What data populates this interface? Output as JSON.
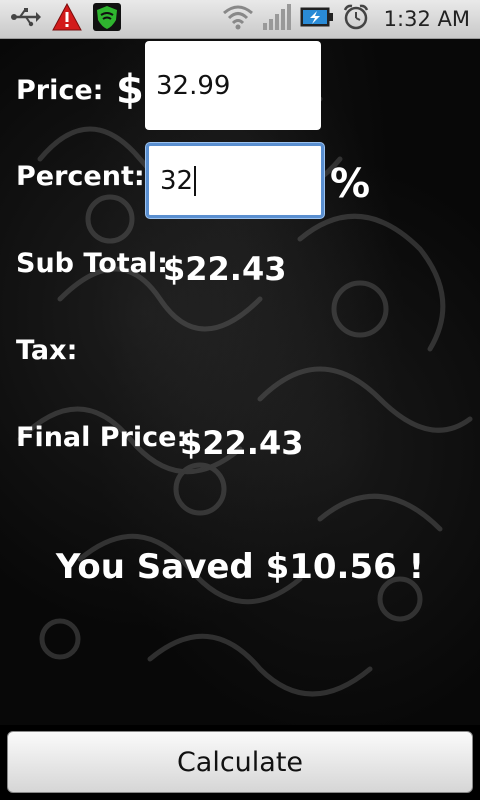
{
  "status_bar": {
    "time": "1:32 AM",
    "icons": [
      "usb-icon",
      "warning-icon",
      "shield-icon",
      "wifi-icon",
      "signal-icon",
      "battery-charging-icon",
      "alarm-icon"
    ]
  },
  "form": {
    "price_label": "Price:",
    "currency_symbol": "$",
    "price_value": "32.99",
    "percent_label": "Percent:",
    "percent_value": "32",
    "percent_symbol": "%",
    "subtotal_label": "Sub Total:",
    "subtotal_value": "$22.43",
    "tax_label": "Tax:",
    "final_label": "Final Price:",
    "final_value": "$22.43"
  },
  "result": {
    "saved_text": "You Saved $10.56 !"
  },
  "actions": {
    "calculate_label": "Calculate"
  },
  "colors": {
    "focus_border": "#5a8fd0",
    "background": "#080808"
  }
}
